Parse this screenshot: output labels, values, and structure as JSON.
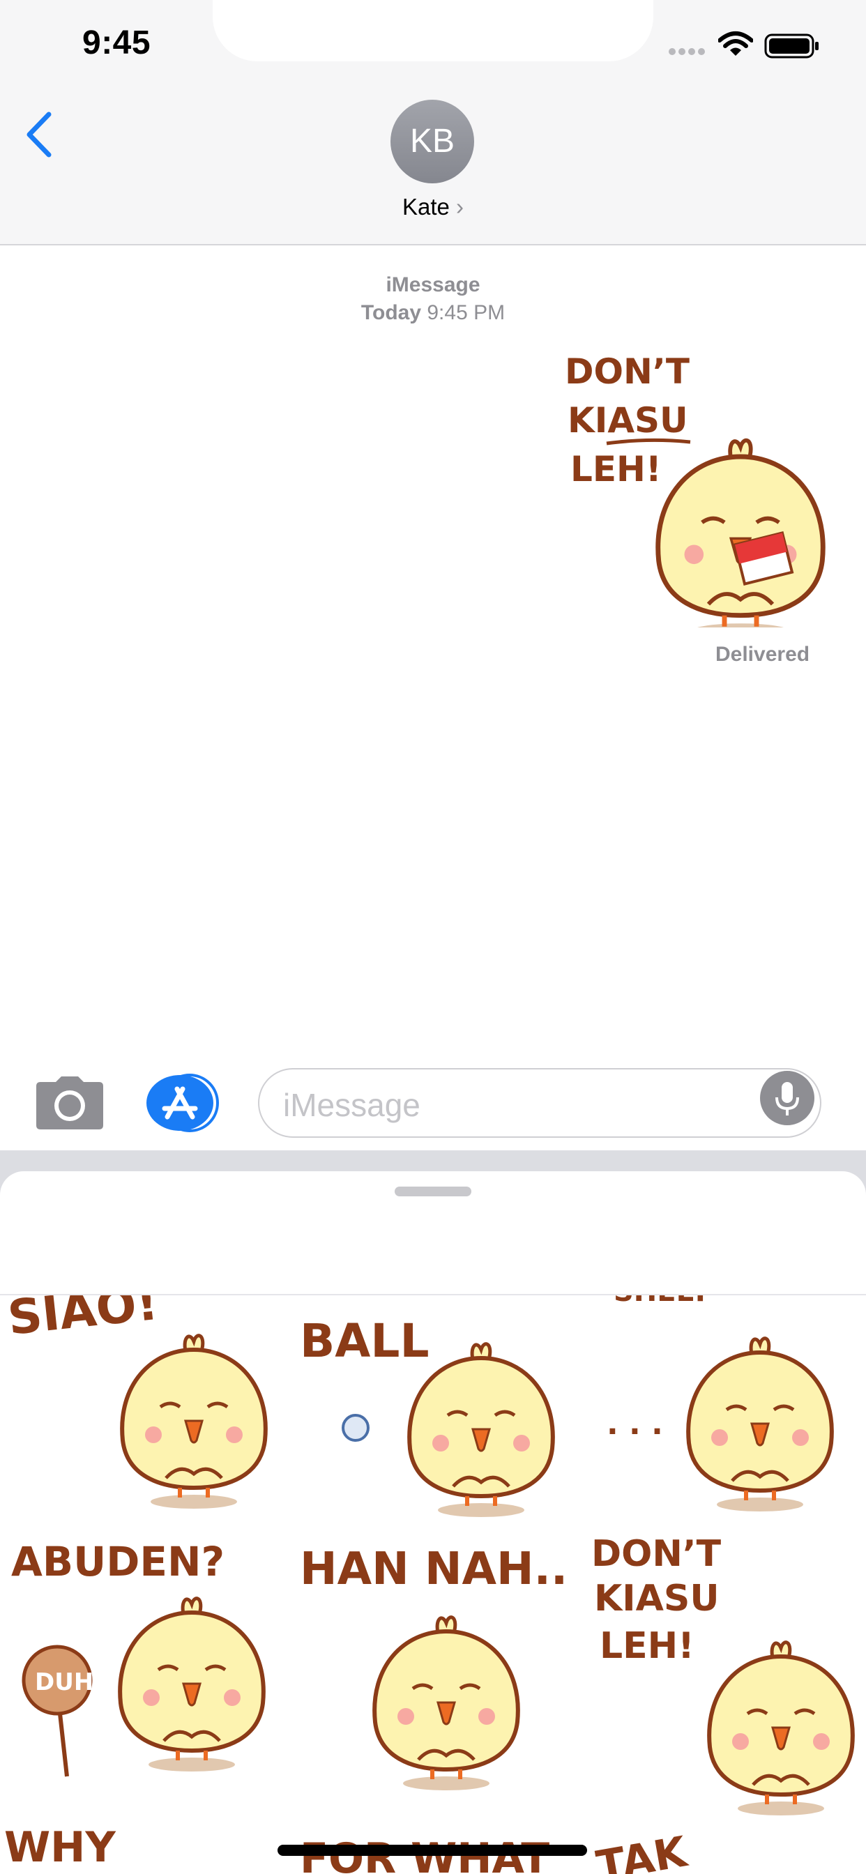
{
  "status_bar": {
    "time": "9:45"
  },
  "header": {
    "avatar_initials": "KB",
    "contact_name": "Kate",
    "contact_chevron": "›"
  },
  "conversation": {
    "service": "iMessage",
    "date_day": "Today",
    "date_time": "9:45 PM",
    "sent_sticker": {
      "line1": "DON’T",
      "line2": "KIASU",
      "line3": "LEH!"
    },
    "delivery_status": "Delivered"
  },
  "input_bar": {
    "placeholder": "iMessage"
  },
  "sticker_drawer": {
    "stickers": [
      {
        "caption": "SIAO!"
      },
      {
        "caption": "BALL"
      },
      {
        "caption": "SHEEP"
      },
      {
        "caption": "ABUDEN?",
        "sign": "DUH"
      },
      {
        "caption": "HAN NAH.."
      },
      {
        "caption_lines": [
          "DON’T",
          "KIASU",
          "LEH!"
        ]
      },
      {
        "caption": "WHY"
      },
      {
        "caption": "FOR WHAT"
      },
      {
        "caption": "TAK"
      }
    ]
  },
  "colors": {
    "ios_blue": "#1a7cf5",
    "sticker_brown": "#8b3b17",
    "chick_yellow": "#fdf3b0"
  }
}
